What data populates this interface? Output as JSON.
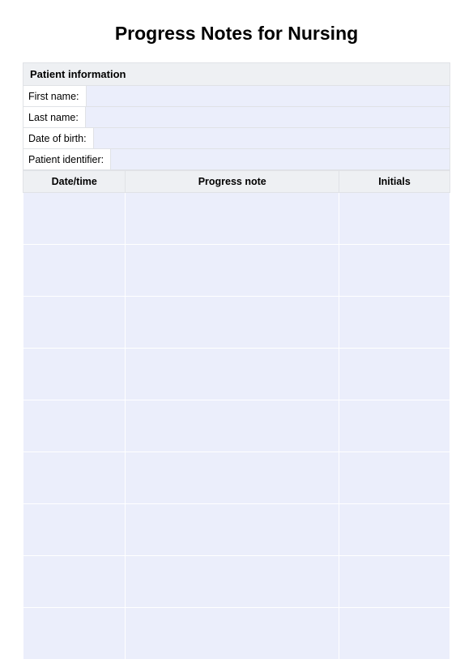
{
  "title": "Progress Notes for Nursing",
  "patient_info": {
    "header": "Patient information",
    "fields": {
      "first_name_label": "First name:",
      "last_name_label": "Last name:",
      "dob_label": "Date of birth:",
      "identifier_label": "Patient identifier:",
      "first_name_value": "",
      "last_name_value": "",
      "dob_value": "",
      "identifier_value": ""
    }
  },
  "notes_table": {
    "headers": {
      "datetime": "Date/time",
      "note": "Progress note",
      "initials": "Initials"
    },
    "rows": [
      {
        "datetime": "",
        "note": "",
        "initials": ""
      },
      {
        "datetime": "",
        "note": "",
        "initials": ""
      },
      {
        "datetime": "",
        "note": "",
        "initials": ""
      },
      {
        "datetime": "",
        "note": "",
        "initials": ""
      },
      {
        "datetime": "",
        "note": "",
        "initials": ""
      },
      {
        "datetime": "",
        "note": "",
        "initials": ""
      },
      {
        "datetime": "",
        "note": "",
        "initials": ""
      },
      {
        "datetime": "",
        "note": "",
        "initials": ""
      },
      {
        "datetime": "",
        "note": "",
        "initials": ""
      }
    ]
  }
}
